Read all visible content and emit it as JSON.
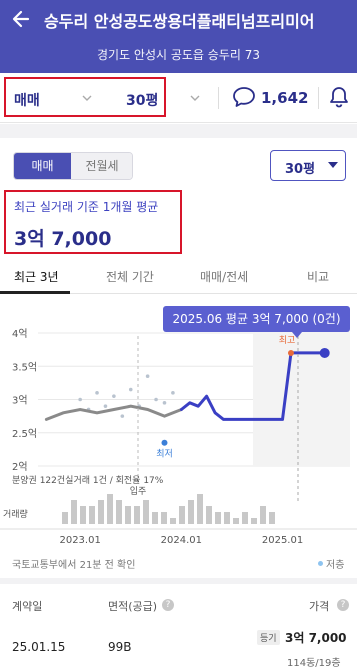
{
  "header": {
    "title": "승두리 안성공도쌍용더플래티넘프리미어",
    "address": "경기도 안성시 공도읍 승두리 73"
  },
  "filters": {
    "trade_type": "매매",
    "area": "30평",
    "comment_count": "1,642"
  },
  "segment": {
    "buy": "매매",
    "rent": "전월세"
  },
  "area_select": "30평",
  "average": {
    "label": "최근 실거래 기준 1개월 평균",
    "value": "3억 7,000"
  },
  "tabs": [
    "최근 3년",
    "전체 기간",
    "매매/전세",
    "비교"
  ],
  "chart_data": {
    "type": "line",
    "tooltip": "2025.06 평균 3억 7,000 (0건)",
    "y_ticks": [
      "4억",
      "3.5억",
      "3억",
      "2.5억",
      "2억"
    ],
    "x_ticks": [
      "2023.01",
      "2024.01",
      "2025.01"
    ],
    "ylim": [
      2.0,
      4.0
    ],
    "xlim": [
      "2022.08",
      "2025.09"
    ],
    "high_label": "최고",
    "low_label": "최저",
    "move_in_label": "입주",
    "volume_label": "거래량",
    "supply_note": "분양권 122건실거래 1건 / 회전율 17%",
    "series": [
      {
        "name": "매매 평균",
        "x": [
          "2022.09",
          "2022.11",
          "2023.01",
          "2023.03",
          "2023.05",
          "2023.07",
          "2023.09",
          "2023.11",
          "2024.01",
          "2024.02",
          "2024.03",
          "2024.04",
          "2024.05",
          "2024.06",
          "2024.08",
          "2024.10",
          "2024.12",
          "2025.01",
          "2025.02",
          "2025.03",
          "2025.04",
          "2025.06"
        ],
        "values": [
          2.7,
          2.8,
          2.85,
          2.8,
          2.85,
          2.9,
          2.85,
          2.75,
          2.85,
          2.95,
          2.9,
          3.05,
          2.8,
          2.7,
          2.7,
          2.7,
          2.7,
          2.7,
          3.7,
          3.7,
          3.7,
          3.7
        ]
      }
    ],
    "scatter": [
      {
        "x": "2023.01",
        "y": 3.0
      },
      {
        "x": "2023.02",
        "y": 2.85
      },
      {
        "x": "2023.03",
        "y": 3.1
      },
      {
        "x": "2023.04",
        "y": 2.9
      },
      {
        "x": "2023.05",
        "y": 3.05
      },
      {
        "x": "2023.06",
        "y": 2.75
      },
      {
        "x": "2023.07",
        "y": 3.15
      },
      {
        "x": "2023.08",
        "y": 2.9
      },
      {
        "x": "2023.09",
        "y": 3.35
      },
      {
        "x": "2023.10",
        "y": 3.0
      },
      {
        "x": "2023.11",
        "y": 2.95
      },
      {
        "x": "2023.12",
        "y": 3.1
      }
    ],
    "volume": [
      2,
      4,
      3,
      3,
      4,
      5,
      4,
      3,
      3,
      4,
      2,
      2,
      1,
      3,
      4,
      5,
      3,
      2,
      2,
      1,
      2,
      1,
      3,
      2
    ],
    "colors": {
      "line": "#3a3fc4",
      "history": "#8a8a8a",
      "accent": "#e86b3a",
      "low": "#3b7fd8"
    }
  },
  "source": "국토교통부에서 21분 전 확인",
  "lowest_legend": "저층",
  "table": {
    "headers": {
      "date": "계약일",
      "area": "면적(공급)",
      "price": "가격"
    },
    "rows": [
      {
        "date": "25.01.15",
        "area": "99B",
        "badge": "등기",
        "price": "3억 7,000",
        "floor": "114동/19층"
      }
    ]
  }
}
